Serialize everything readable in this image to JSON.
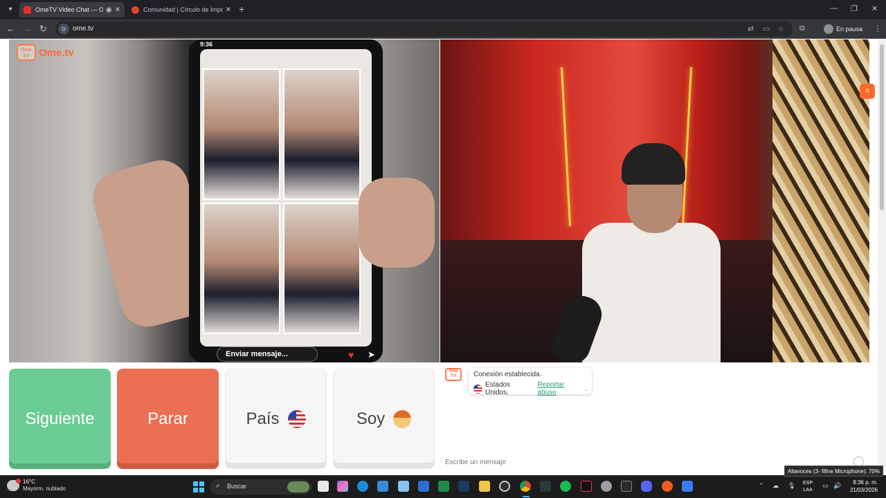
{
  "browser": {
    "tabs": [
      {
        "title": "OmeTV Video Chat — Ome",
        "active": true,
        "favicon_color": "#e0322b"
      },
      {
        "title": "Comunidad | Círculo de Importa",
        "active": false,
        "favicon_color": "#e0462b"
      }
    ],
    "url": "ome.tv",
    "profile_label": "En pausa"
  },
  "page": {
    "logo_text": "Ome.tv",
    "logo_badge": "Ome TV",
    "left_video": {
      "phone_time": "9:36",
      "phone_message_placeholder": "Enviar mensaje..."
    },
    "buttons": {
      "next": "Siguiente",
      "stop": "Parar",
      "country": "País",
      "soy": "Soy"
    },
    "chat": {
      "logo_badge": "Ome TV",
      "connection": "Conexión establecida.",
      "country": "Estados Unidos.",
      "report": "Reportar abuso",
      "report_suffix": ".",
      "input_placeholder": "Escribe un mensaje"
    },
    "colors": {
      "next": "#6ccd94",
      "stop": "#eb6f52",
      "brand": "#ff6a3a"
    }
  },
  "tooltip": "Altavoces (3- fifine Microphone): 70%",
  "taskbar": {
    "weather_temp": "16°C",
    "weather_condition": "Mayorm. nublado",
    "search_label": "Buscar",
    "lang_line1": "ESP",
    "lang_line2": "LAA",
    "time": "8:36 p. m.",
    "date": "21/03/2026",
    "apps": [
      "file-manager",
      "copilot",
      "edge",
      "store",
      "remote",
      "word",
      "excel",
      "steam",
      "folder",
      "obs",
      "chrome",
      "capcut",
      "spotify",
      "tiktok",
      "settings",
      "epic",
      "discord",
      "brave",
      "vpn"
    ]
  }
}
